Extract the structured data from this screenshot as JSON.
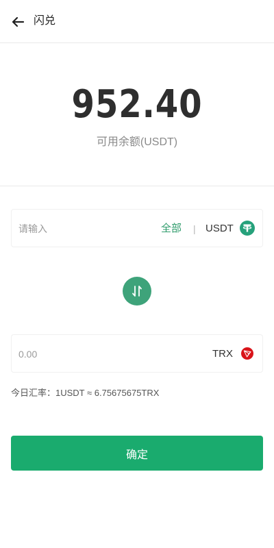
{
  "header": {
    "title": "闪兑",
    "back_icon": "arrow-left-icon"
  },
  "balance": {
    "amount": "952.40",
    "label": "可用余额(USDT)"
  },
  "from": {
    "placeholder": "请输入",
    "all_label": "全部",
    "separator": "|",
    "currency": "USDT",
    "icon": "usdt-icon",
    "icon_color": "#26a17b"
  },
  "swap": {
    "icon": "swap-arrows-icon",
    "color": "#3ea37a"
  },
  "to": {
    "placeholder": "0.00",
    "currency": "TRX",
    "icon": "trx-icon",
    "icon_color": "#d9141a"
  },
  "rate": {
    "text": "今日汇率：1USDT ≈ 6.75675675TRX"
  },
  "confirm": {
    "label": "确定",
    "color": "#1aab6e"
  }
}
